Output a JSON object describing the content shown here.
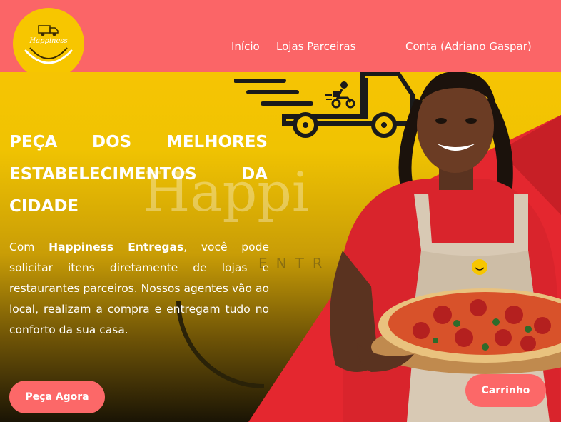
{
  "header": {
    "logo_text": "Happiness",
    "nav": {
      "home": "Início",
      "partner_stores": "Lojas Parceiras",
      "account": "Conta (Adriano Gaspar)"
    }
  },
  "hero": {
    "watermark": "Happi",
    "watermark_sub": "ENTR",
    "headline": "PEÇA DOS MELHORES ESTABELECIMENTOS DA CIDADE",
    "body_prefix": "Com ",
    "body_brand": "Happiness Entregas",
    "body_suffix": ", você pode solicitar itens diretamente de lojas e restaurantes parceiros. Nossos agentes vão ao local, realizam a compra e entregam tudo no conforto da sua casa.",
    "order_button": "Peça Agora",
    "cart_button": "Carrinho"
  },
  "colors": {
    "header": "#fb6567",
    "logo": "#f7c600",
    "hero_yellow": "#f6c403",
    "accent_red": "#e4272f"
  },
  "icons": [
    "delivery-truck-icon",
    "motorbike-courier-icon",
    "smile-logo-icon"
  ]
}
